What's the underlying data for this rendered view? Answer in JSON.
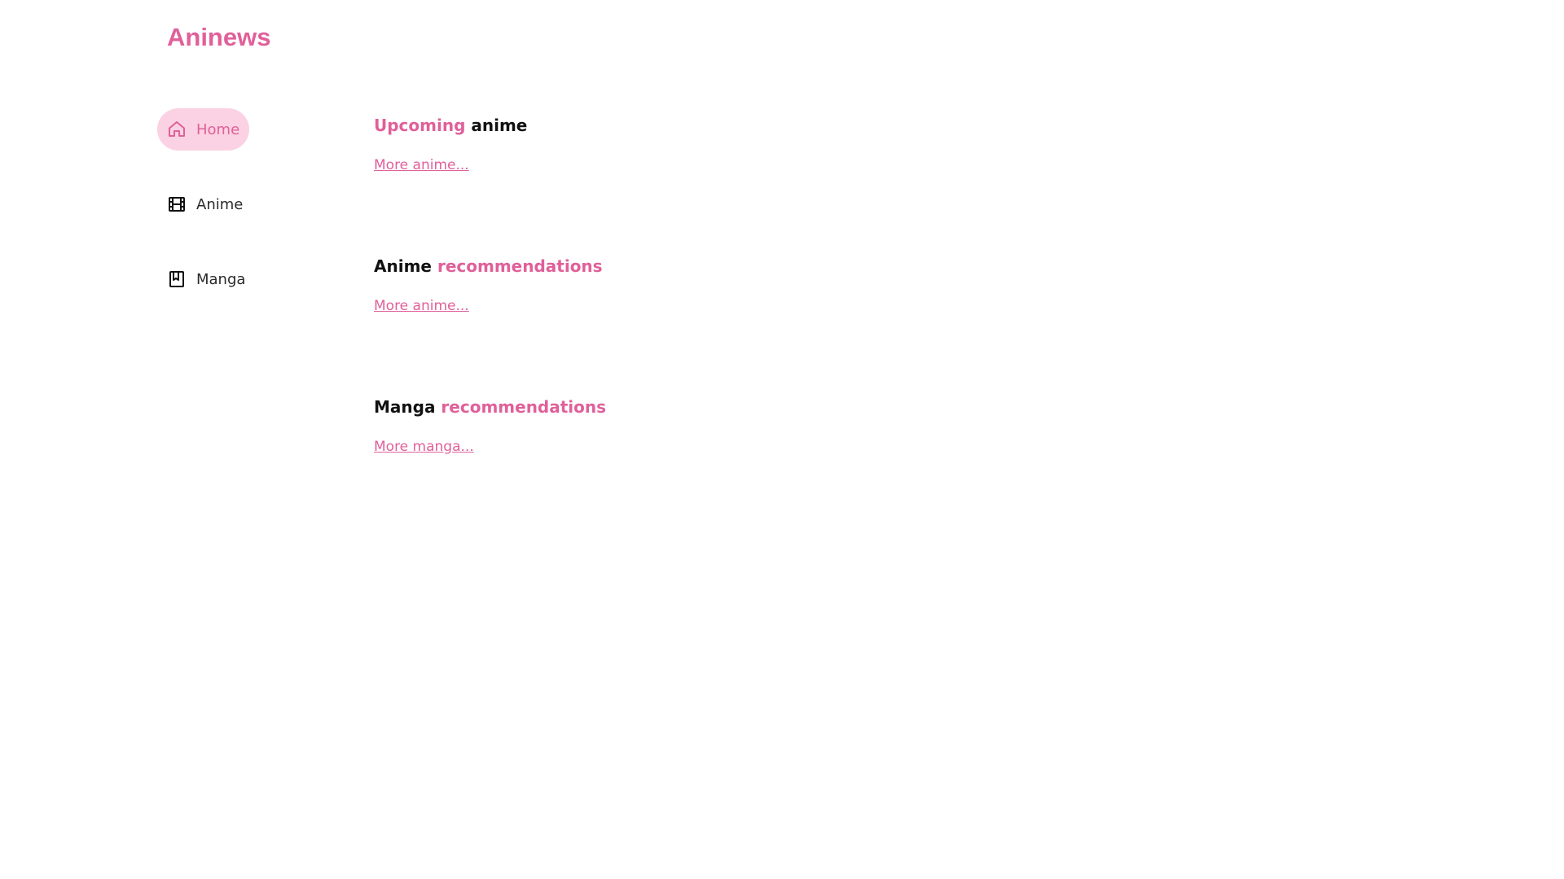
{
  "app": {
    "logo": "Aninews"
  },
  "sidebar": {
    "items": [
      {
        "label": "Home",
        "icon": "home-icon",
        "active": true
      },
      {
        "label": "Anime",
        "icon": "film-icon",
        "active": false
      },
      {
        "label": "Manga",
        "icon": "book-icon",
        "active": false
      }
    ]
  },
  "main": {
    "sections": [
      {
        "title_part1": "Upcoming",
        "title_part2": "anime",
        "link": "More anime..."
      },
      {
        "title_part1": "Anime",
        "title_part2": "recommendations",
        "link": "More anime..."
      },
      {
        "title_part1": "Manga",
        "title_part2": "recommendations",
        "link": "More manga..."
      }
    ]
  },
  "colors": {
    "accent": "#e0609a",
    "active_bg": "#fbd2e3",
    "text": "#111111"
  }
}
